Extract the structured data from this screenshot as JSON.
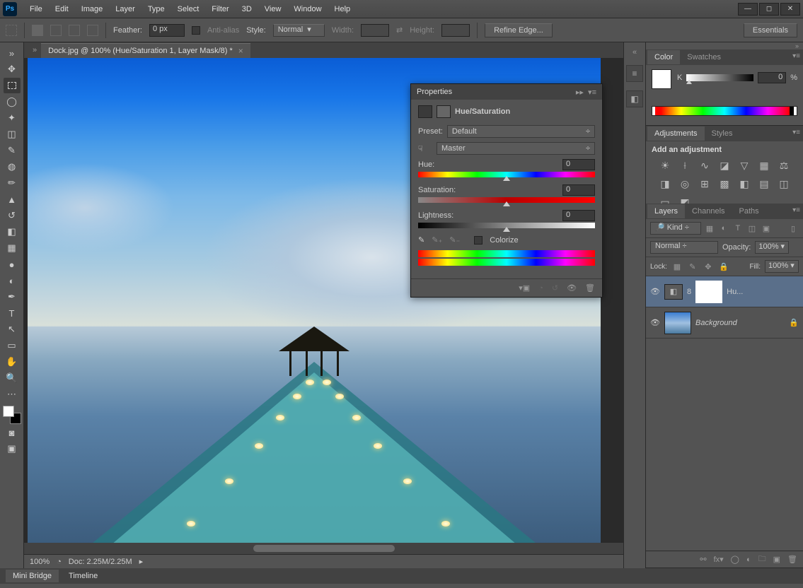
{
  "app": {
    "name": "Ps"
  },
  "menu": [
    "File",
    "Edit",
    "Image",
    "Layer",
    "Type",
    "Select",
    "Filter",
    "3D",
    "View",
    "Window",
    "Help"
  ],
  "options": {
    "feather_label": "Feather:",
    "feather_value": "0 px",
    "antialias": "Anti-alias",
    "style_label": "Style:",
    "style_value": "Normal",
    "width_label": "Width:",
    "height_label": "Height:",
    "refine": "Refine Edge...",
    "essentials": "Essentials"
  },
  "document": {
    "tab_title": "Dock.jpg @ 100% (Hue/Saturation 1, Layer Mask/8) *",
    "zoom": "100%",
    "doc_size": "Doc: 2.25M/2.25M"
  },
  "bottom_tabs": [
    "Mini Bridge",
    "Timeline"
  ],
  "properties": {
    "title": "Properties",
    "adjustment_name": "Hue/Saturation",
    "preset_label": "Preset:",
    "preset_value": "Default",
    "channel_value": "Master",
    "hue_label": "Hue:",
    "hue_value": "0",
    "sat_label": "Saturation:",
    "sat_value": "0",
    "lig_label": "Lightness:",
    "lig_value": "0",
    "colorize": "Colorize"
  },
  "color_panel": {
    "tabs": [
      "Color",
      "Swatches"
    ],
    "k_label": "K",
    "k_value": "0",
    "k_unit": "%"
  },
  "adjustments_panel": {
    "tabs": [
      "Adjustments",
      "Styles"
    ],
    "title": "Add an adjustment"
  },
  "layers_panel": {
    "tabs": [
      "Layers",
      "Channels",
      "Paths"
    ],
    "kind": "Kind",
    "blend": "Normal",
    "opacity_label": "Opacity:",
    "opacity_value": "100%",
    "lock_label": "Lock:",
    "fill_label": "Fill:",
    "fill_value": "100%",
    "layers": [
      {
        "name": "Hu...",
        "type": "adjustment",
        "active": true
      },
      {
        "name": "Background",
        "type": "image",
        "locked": true,
        "italic": true
      }
    ]
  }
}
